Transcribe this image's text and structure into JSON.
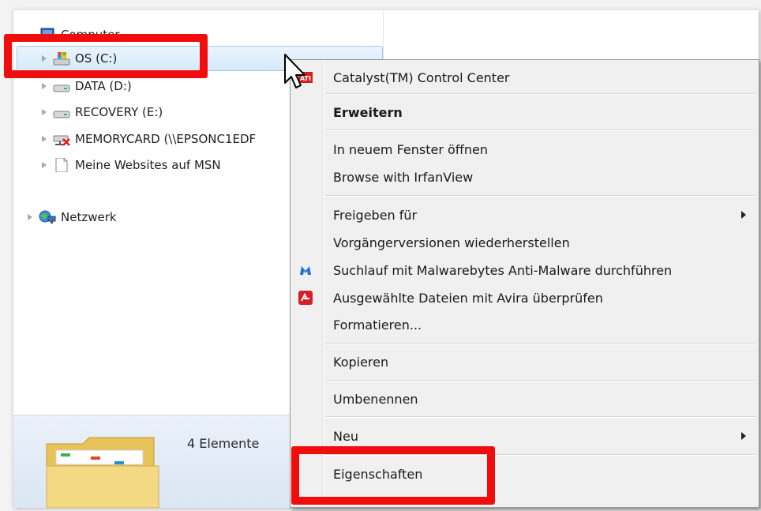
{
  "tree": {
    "computer": "Computer",
    "drives": [
      {
        "label": "OS (C:)",
        "icon": "windows-drive-icon"
      },
      {
        "label": "DATA (D:)",
        "icon": "drive-icon"
      },
      {
        "label": "RECOVERY (E:)",
        "icon": "drive-icon"
      },
      {
        "label": "MEMORYCARD (\\\\EPSONC1EDF",
        "icon": "network-drive-disconnected-icon"
      },
      {
        "label": "Meine Websites auf MSN",
        "icon": "document-icon"
      }
    ],
    "network": "Netzwerk"
  },
  "details": {
    "count": "4 Elemente"
  },
  "context_menu": {
    "items": [
      {
        "label": "Catalyst(TM) Control Center",
        "icon": "ati-icon"
      },
      {
        "label": "Erweitern",
        "bold": true
      },
      {
        "label": "In neuem Fenster öffnen"
      },
      {
        "label": "Browse with IrfanView"
      },
      {
        "label": "Freigeben für",
        "submenu": true
      },
      {
        "label": "Vorgängerversionen wiederherstellen"
      },
      {
        "label": "Suchlauf mit Malwarebytes Anti-Malware durchführen",
        "icon": "malwarebytes-icon"
      },
      {
        "label": "Ausgewählte Dateien mit Avira überprüfen",
        "icon": "avira-icon"
      },
      {
        "label": "Formatieren..."
      },
      {
        "label": "Kopieren"
      },
      {
        "label": "Umbenennen"
      },
      {
        "label": "Neu",
        "submenu": true
      },
      {
        "label": "Eigenschaften"
      }
    ]
  },
  "colors": {
    "highlight": "#f10d0d",
    "selection": "#d6eafb",
    "menu_bg": "#f0f0f0"
  }
}
